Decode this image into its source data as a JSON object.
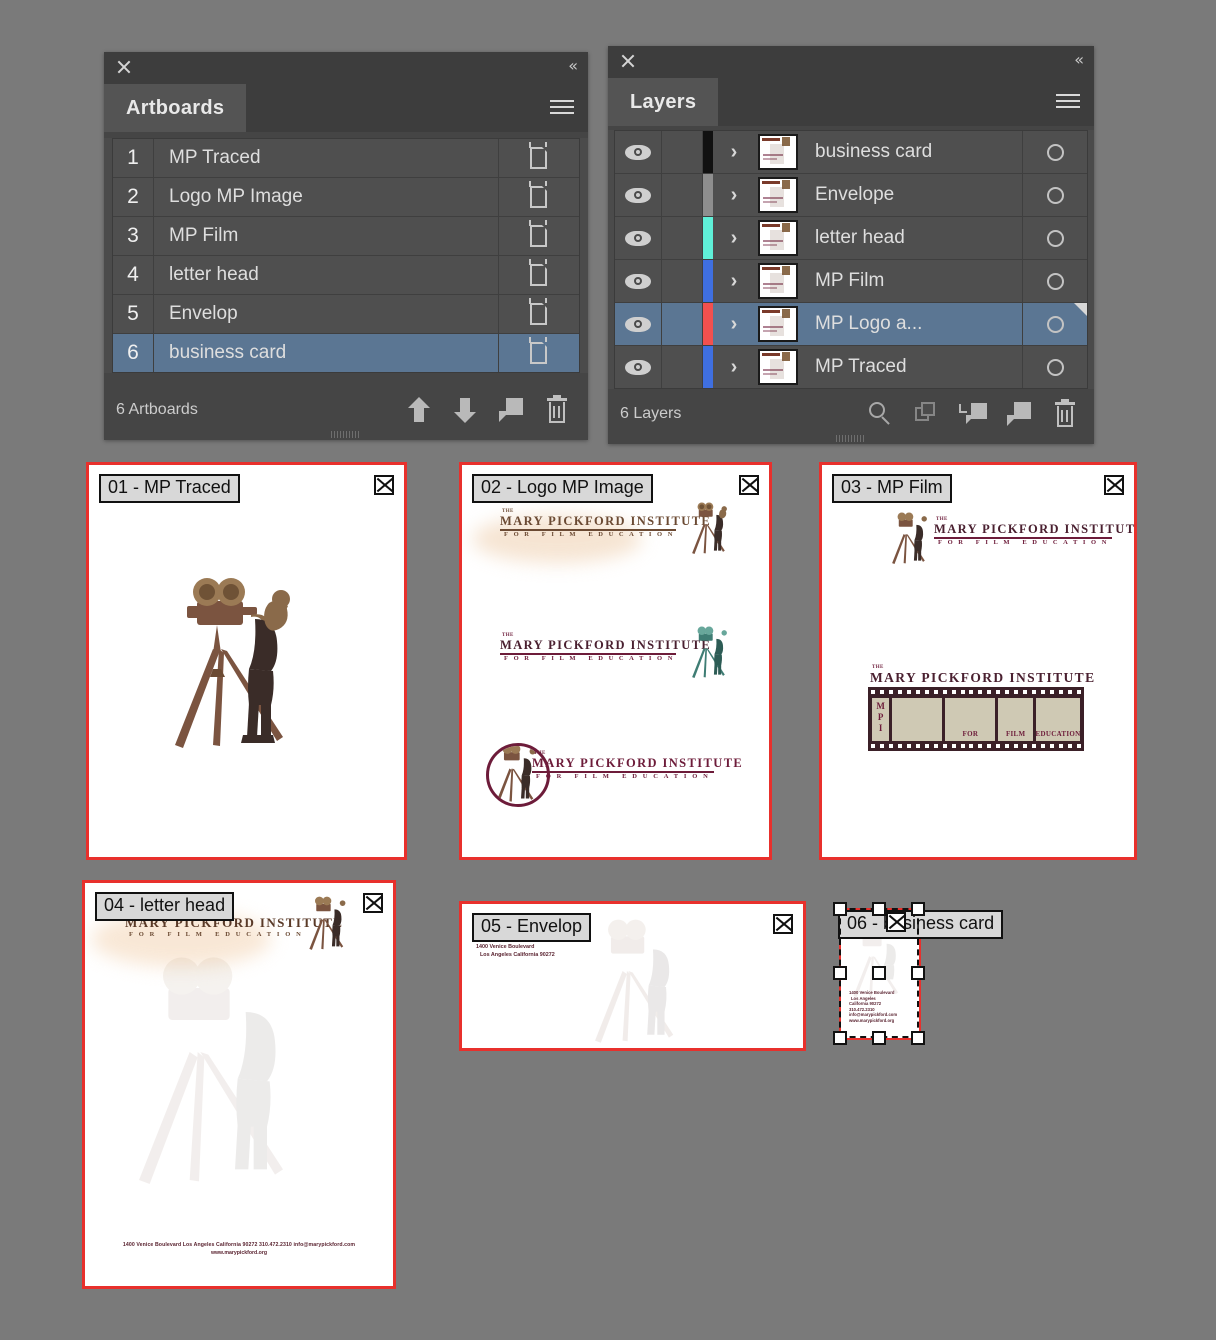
{
  "app": {
    "background_color": "#7a7a7a",
    "accent_selection": "#5b7693",
    "artboard_border": "#e8302c"
  },
  "artboards_panel": {
    "title": "Artboards",
    "close_icon": "close-icon",
    "collapse_icon": "double-chevron-left-icon",
    "menu_icon": "panel-menu-icon",
    "rows": [
      {
        "num": "1",
        "name": "MP Traced",
        "selected": false
      },
      {
        "num": "2",
        "name": "Logo MP Image",
        "selected": false
      },
      {
        "num": "3",
        "name": "MP Film",
        "selected": false
      },
      {
        "num": "4",
        "name": "letter head",
        "selected": false
      },
      {
        "num": "5",
        "name": "Envelop",
        "selected": false
      },
      {
        "num": "6",
        "name": "business card",
        "selected": true
      }
    ],
    "footer_count": "6 Artboards",
    "footer_buttons": [
      {
        "name": "move-up-button",
        "icon": "arrow-up-icon"
      },
      {
        "name": "move-down-button",
        "icon": "arrow-down-icon"
      },
      {
        "name": "new-artboard-button",
        "icon": "new-page-icon"
      },
      {
        "name": "delete-artboard-button",
        "icon": "trash-icon"
      }
    ]
  },
  "layers_panel": {
    "title": "Layers",
    "close_icon": "close-icon",
    "collapse_icon": "double-chevron-left-icon",
    "menu_icon": "panel-menu-icon",
    "rows": [
      {
        "name": "business card",
        "color": "#111111",
        "selected": false,
        "visible": true
      },
      {
        "name": "Envelope",
        "color": "#8e8e8e",
        "selected": false,
        "visible": true
      },
      {
        "name": "letter head",
        "color": "#5ff0d8",
        "selected": false,
        "visible": true
      },
      {
        "name": "MP Film",
        "color": "#3f6fe0",
        "selected": false,
        "visible": true
      },
      {
        "name": "MP Logo a...",
        "color": "#f2504f",
        "selected": true,
        "visible": true
      },
      {
        "name": "MP Traced",
        "color": "#3f6fe0",
        "selected": false,
        "visible": true
      }
    ],
    "footer_count": "6 Layers",
    "footer_buttons": [
      {
        "name": "locate-object-button",
        "icon": "magnifier-icon"
      },
      {
        "name": "make-clipping-mask-button",
        "icon": "overlapping-squares-icon"
      },
      {
        "name": "release-to-layers-button",
        "icon": "release-to-layers-icon"
      },
      {
        "name": "create-new-layer-button",
        "icon": "new-layer-icon"
      },
      {
        "name": "delete-layer-button",
        "icon": "trash-icon"
      }
    ]
  },
  "brand": {
    "the": "THE",
    "name": "MARY PICKFORD INSTITUTE",
    "tagline": "FOR FILM EDUCATION",
    "colors": {
      "sepia": "#6b4a33",
      "maroon": "#6d1c3a",
      "teal": "#3f7d74"
    }
  },
  "canvas": {
    "artboards": [
      {
        "id": "01",
        "label": "01 - MP Traced",
        "close_icon": "artboard-close-icon"
      },
      {
        "id": "02",
        "label": "02 - Logo MP Image",
        "close_icon": "artboard-close-icon"
      },
      {
        "id": "03",
        "label": "03 - MP Film",
        "close_icon": "artboard-close-icon"
      },
      {
        "id": "04",
        "label": "04 - letter head",
        "close_icon": "artboard-close-icon"
      },
      {
        "id": "05",
        "label": "05 - Envelop",
        "close_icon": "artboard-close-icon"
      },
      {
        "id": "06",
        "label": "06 - business card",
        "close_icon": "artboard-close-icon"
      }
    ],
    "film_strip": {
      "left_letters": [
        "M",
        "P",
        "I"
      ],
      "frame_labels": [
        "",
        "FOR",
        "FILM",
        "EDUCATION"
      ]
    },
    "envelope_address": {
      "line1": "1400 Venice Boulevard",
      "line2": "Los Angeles California  90272"
    },
    "letterhead_footer": {
      "line1": "1400 Venice Boulevard  Los Angeles  California  90272  310.472.2310  info@marypickford.com",
      "line2": "www.marypickford.org"
    },
    "business_card_address": {
      "line1": "1400 Venice Boulevard",
      "line2": "Los Angeles",
      "line3": "California  90272",
      "line4": "310.472.2310",
      "line5": "info@marypickford.com",
      "line6": "www.marypickford.org"
    }
  }
}
